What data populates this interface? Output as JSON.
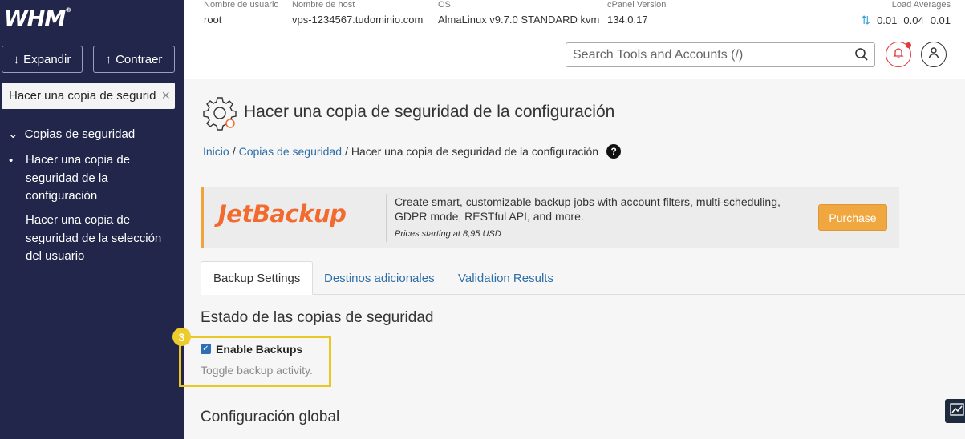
{
  "sidebar": {
    "logo": "WHM",
    "expand_label": "Expandir",
    "collapse_label": "Contraer",
    "search_value": "Hacer una copia de segurid",
    "category": "Copias de seguridad",
    "items": [
      {
        "label": "Hacer una copia de seguridad de la configuración"
      },
      {
        "label": "Hacer una copia de seguridad de la selección del usuario"
      }
    ]
  },
  "topbar": {
    "username_label": "Nombre de usuario",
    "username": "root",
    "hostname_label": "Nombre de host",
    "hostname": "vps-1234567.tudominio.com",
    "os_label": "OS",
    "os": "AlmaLinux v9.7.0 STANDARD kvm",
    "cpanel_label": "cPanel Version",
    "cpanel": "134.0.17",
    "load_label": "Load Averages",
    "load": [
      "0.01",
      "0.04",
      "0.01"
    ]
  },
  "header": {
    "search_placeholder": "Search Tools and Accounts (/)"
  },
  "page": {
    "title": "Hacer una copia de seguridad de la configuración",
    "breadcrumb": [
      "Inicio",
      "Copias de seguridad",
      "Hacer una copia de seguridad de la configuración"
    ],
    "breadcrumb_sep": "/"
  },
  "promo": {
    "brand": "JetBackup",
    "text": "Create smart, customizable backup jobs with account filters, multi-scheduling, GDPR mode, RESTful API, and more.",
    "price": "Prices starting at 8,95 USD",
    "button": "Purchase",
    "accent": "#f0a33a"
  },
  "tabs": [
    "Backup Settings",
    "Destinos adicionales",
    "Validation Results"
  ],
  "content": {
    "section1": "Estado de las copias de seguridad",
    "step_number": "3",
    "enable_label": "Enable Backups",
    "enable_checked": true,
    "enable_help": "Toggle backup activity.",
    "section2": "Configuración global"
  },
  "colors": {
    "sidebar_bg": "#21264a",
    "link": "#2f6fa7",
    "highlight": "#e9c825",
    "notify": "#e0393e"
  }
}
